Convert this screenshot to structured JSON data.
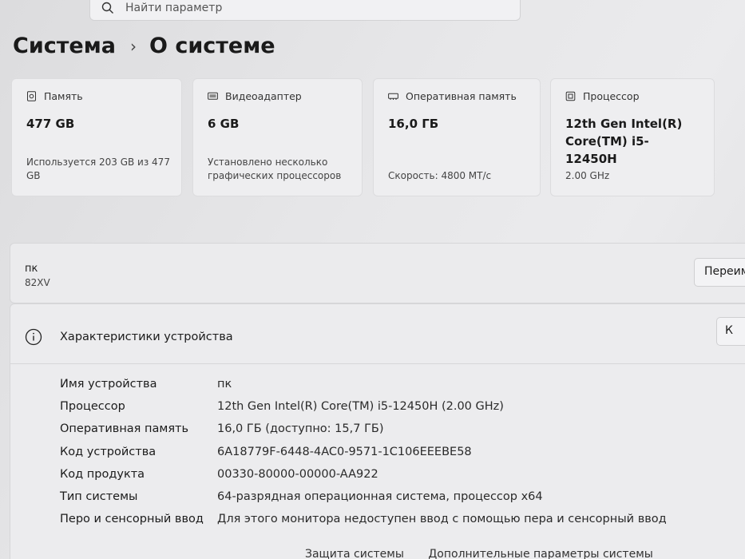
{
  "search": {
    "placeholder": "Найти параметр"
  },
  "breadcrumb": {
    "parent": "Система",
    "current": "О системе"
  },
  "cards": [
    {
      "icon": "storage-icon",
      "label": "Память",
      "value": "477 GB",
      "sub": "Используется 203 GB из 477 GB"
    },
    {
      "icon": "display-adapter-icon",
      "label": "Видеоадаптер",
      "value": "6 GB",
      "sub": "Установлено несколько графических процессоров"
    },
    {
      "icon": "ram-icon",
      "label": "Оперативная память",
      "value": "16,0 ГБ",
      "sub": "Скорость: 4800 МТ/с"
    },
    {
      "icon": "processor-icon",
      "label": "Процессор",
      "value": "12th Gen Intel(R) Core(TM) i5-12450H",
      "sub": "2.00 GHz"
    }
  ],
  "pc": {
    "name": "пк",
    "model": "82XV",
    "rename_label": "Переим"
  },
  "specs": {
    "title": "Характеристики устройства",
    "copy_label": "К",
    "rows": [
      {
        "key": "Имя устройства",
        "value": "пк"
      },
      {
        "key": "Процессор",
        "value": "12th Gen Intel(R) Core(TM) i5-12450H (2.00 GHz)"
      },
      {
        "key": "Оперативная память",
        "value": "16,0 ГБ (доступно: 15,7 ГБ)"
      },
      {
        "key": "Код устройства",
        "value": "6A18779F-6448-4AC0-9571-1C106EEEBE58"
      },
      {
        "key": "Код продукта",
        "value": "00330-80000-00000-AA922"
      },
      {
        "key": "Тип системы",
        "value": "64-разрядная операционная система, процессор x64"
      },
      {
        "key": "Перо и сенсорный ввод",
        "value": "Для этого монитора недоступен ввод с помощью пера и сенсорный ввод"
      }
    ]
  },
  "links": {
    "protection": "Защита системы",
    "advanced": "Дополнительные параметры системы"
  }
}
